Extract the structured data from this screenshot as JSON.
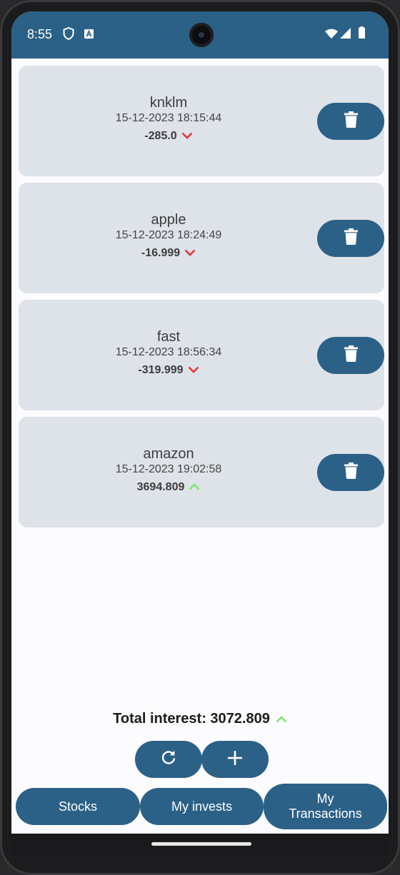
{
  "status_bar": {
    "time": "8:55",
    "background": "#2c6187"
  },
  "transactions": [
    {
      "name": "knklm",
      "datetime": "15-12-2023 18:15:44",
      "amount": "-285.0",
      "trend": "down"
    },
    {
      "name": "apple",
      "datetime": "15-12-2023 18:24:49",
      "amount": "-16.999",
      "trend": "down"
    },
    {
      "name": "fast",
      "datetime": "15-12-2023 18:56:34",
      "amount": "-319.999",
      "trend": "down"
    },
    {
      "name": "amazon",
      "datetime": "15-12-2023 19:02:58",
      "amount": "3694.809",
      "trend": "up"
    }
  ],
  "total": {
    "label": "Total interest: 3072.809",
    "trend": "up"
  },
  "actions": {
    "refresh_icon": "refresh-icon",
    "add_icon": "plus-icon"
  },
  "nav": {
    "stocks": "Stocks",
    "my_invests": "My invests",
    "my_transactions_line1": "My",
    "my_transactions_line2": "Transactions"
  },
  "colors": {
    "primary": "#2c6187",
    "card": "#dee2e9",
    "down": "#e53935",
    "up": "#7be86d"
  }
}
